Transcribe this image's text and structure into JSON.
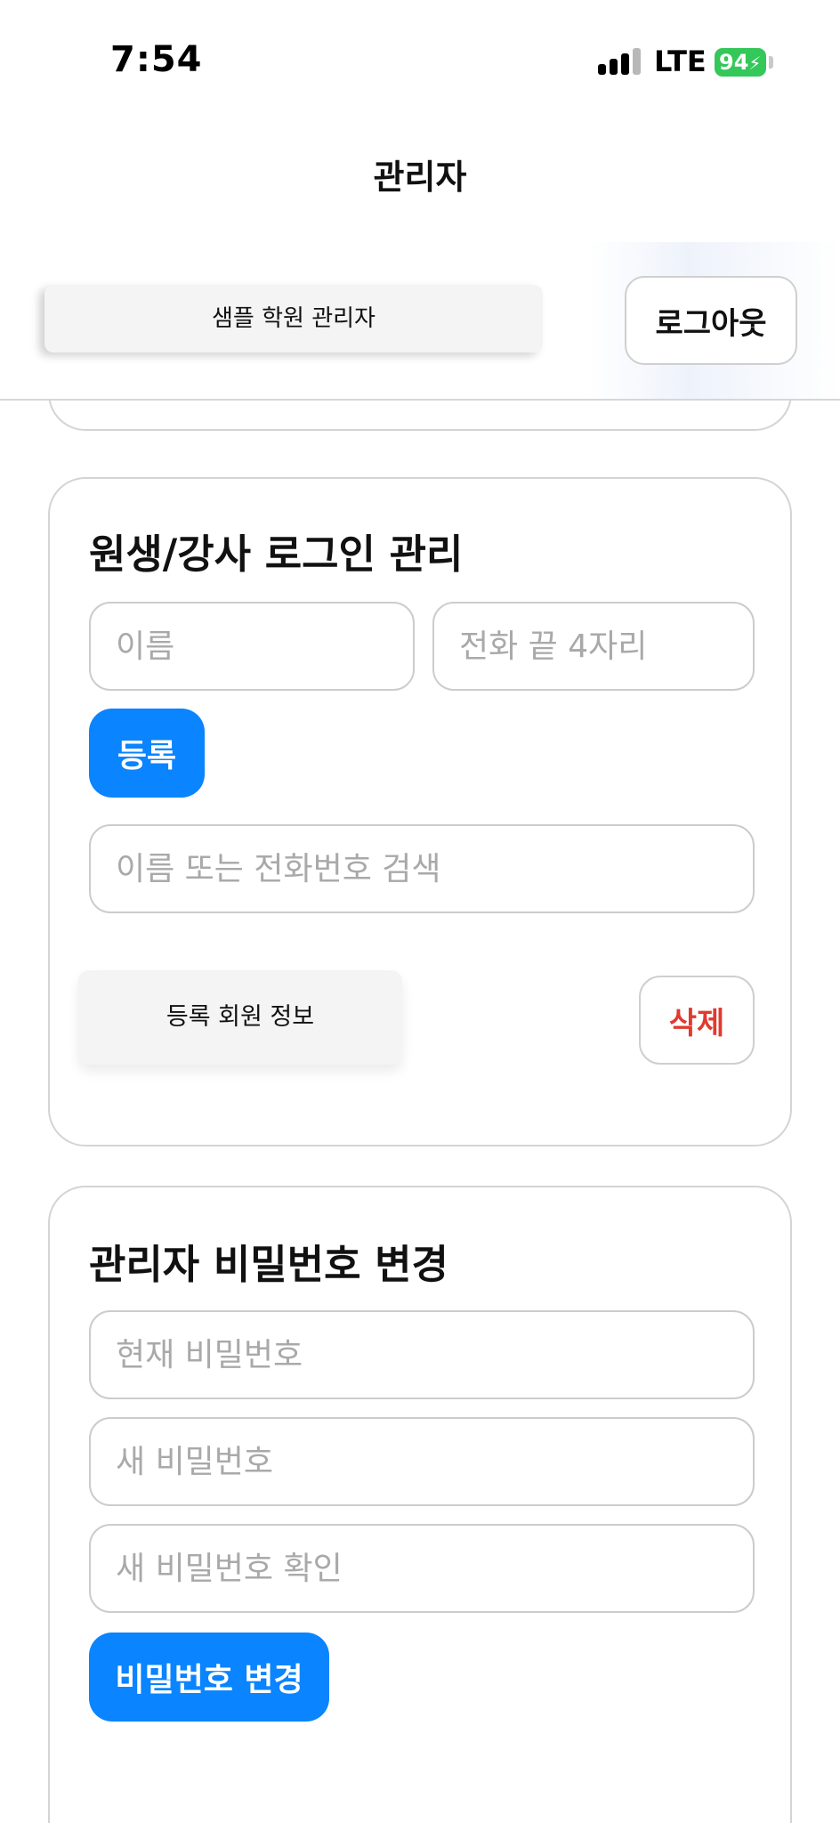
{
  "status_bar": {
    "time": "7:54",
    "network": "LTE",
    "battery": "94",
    "battery_color": "#34c759"
  },
  "header": {
    "title": "관리자",
    "org_name": "샘플 학원 관리자",
    "logout_label": "로그아웃"
  },
  "members_section": {
    "title": "원생/강사 로그인 관리",
    "name_placeholder": "이름",
    "phone_placeholder": "전화 끝 4자리",
    "register_label": "등록",
    "search_placeholder": "이름 또는 전화번호 검색",
    "member_info_label": "등록 회원 정보",
    "delete_label": "삭제"
  },
  "password_section": {
    "title": "관리자 비밀번호 변경",
    "current_placeholder": "현재 비밀번호",
    "new_placeholder": "새 비밀번호",
    "confirm_placeholder": "새 비밀번호 확인",
    "submit_label": "비밀번호 변경"
  },
  "colors": {
    "primary": "#0a84ff",
    "danger": "#e03a2f",
    "border": "#d4d4d4"
  }
}
